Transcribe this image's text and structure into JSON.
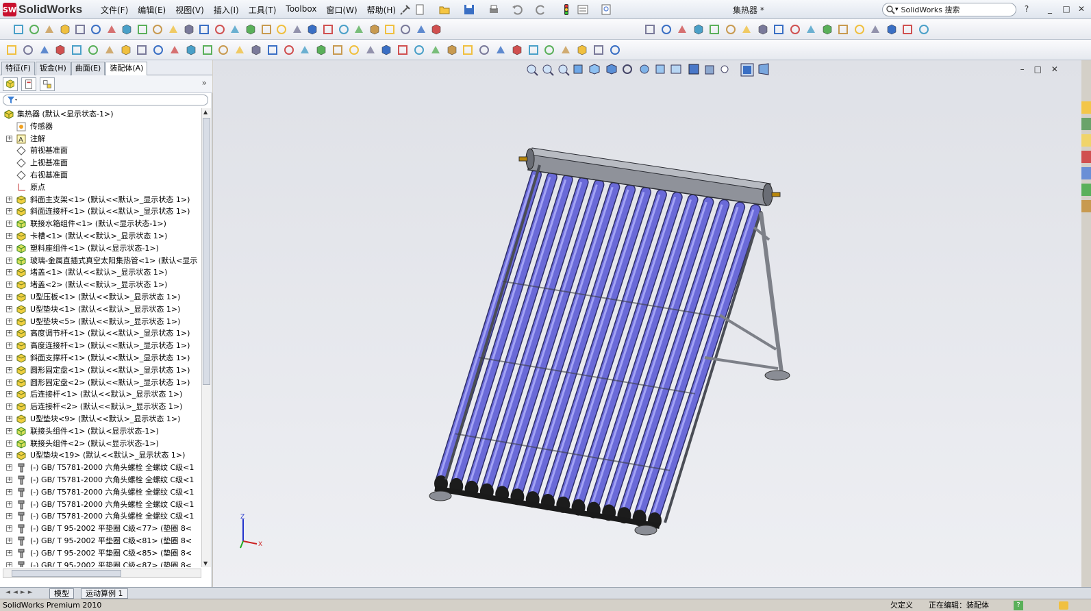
{
  "app": {
    "brand": "SolidWorks",
    "logo_letters": "SW",
    "document_title": "集热器 *",
    "search_placeholder": "SolidWorks 搜索"
  },
  "menus": [
    "文件(F)",
    "编辑(E)",
    "视图(V)",
    "插入(I)",
    "工具(T)",
    "Toolbox",
    "窗口(W)",
    "帮助(H)"
  ],
  "command_manager_tabs": [
    "特征(F)",
    "钣金(H)",
    "曲面(E)",
    "装配体(A)"
  ],
  "active_tab": "装配体(A)",
  "tree": {
    "root": "集热器  (默认<显示状态-1>)",
    "items": [
      {
        "label": "传感器",
        "icon": "sensor-icon",
        "expandable": false
      },
      {
        "label": "注解",
        "icon": "annotation-icon",
        "expandable": true
      },
      {
        "label": "前视基准面",
        "icon": "plane-icon",
        "expandable": false
      },
      {
        "label": "上视基准面",
        "icon": "plane-icon",
        "expandable": false
      },
      {
        "label": "右视基准面",
        "icon": "plane-icon",
        "expandable": false
      },
      {
        "label": "原点",
        "icon": "origin-icon",
        "expandable": false
      },
      {
        "label": "斜面主支架<1> (默认<<默认>_显示状态 1>)",
        "icon": "part-icon",
        "expandable": true
      },
      {
        "label": "斜面连接杆<1> (默认<<默认>_显示状态 1>)",
        "icon": "part-icon",
        "expandable": true
      },
      {
        "label": "联接水箱组件<1> (默认<显示状态-1>)",
        "icon": "subassembly-icon",
        "expandable": true
      },
      {
        "label": "卡槽<1> (默认<<默认>_显示状态 1>)",
        "icon": "part-icon",
        "expandable": true
      },
      {
        "label": "塑料座组件<1> (默认<显示状态-1>)",
        "icon": "subassembly-icon",
        "expandable": true
      },
      {
        "label": "玻璃-金属直插式真空太阳集热管<1> (默认<显示",
        "icon": "subassembly-icon",
        "expandable": true
      },
      {
        "label": "堵盖<1> (默认<<默认>_显示状态 1>)",
        "icon": "part-icon",
        "expandable": true
      },
      {
        "label": "堵盖<2> (默认<<默认>_显示状态 1>)",
        "icon": "part-icon",
        "expandable": true
      },
      {
        "label": "U型压板<1> (默认<<默认>_显示状态 1>)",
        "icon": "part-icon",
        "expandable": true
      },
      {
        "label": "U型垫块<1> (默认<<默认>_显示状态 1>)",
        "icon": "part-icon",
        "expandable": true
      },
      {
        "label": "U型垫块<5> (默认<<默认>_显示状态 1>)",
        "icon": "part-icon",
        "expandable": true
      },
      {
        "label": "高度调节杆<1> (默认<<默认>_显示状态 1>)",
        "icon": "part-icon",
        "expandable": true
      },
      {
        "label": "高度连接杆<1> (默认<<默认>_显示状态 1>)",
        "icon": "part-icon",
        "expandable": true
      },
      {
        "label": "斜面支撑杆<1> (默认<<默认>_显示状态 1>)",
        "icon": "part-icon",
        "expandable": true
      },
      {
        "label": "圆形固定盘<1> (默认<<默认>_显示状态 1>)",
        "icon": "part-icon",
        "expandable": true
      },
      {
        "label": "圆形固定盘<2> (默认<<默认>_显示状态 1>)",
        "icon": "part-icon",
        "expandable": true
      },
      {
        "label": "后连接杆<1> (默认<<默认>_显示状态 1>)",
        "icon": "part-icon",
        "expandable": true
      },
      {
        "label": "后连接杆<2> (默认<<默认>_显示状态 1>)",
        "icon": "part-icon",
        "expandable": true
      },
      {
        "label": "U型垫块<9> (默认<<默认>_显示状态 1>)",
        "icon": "part-icon",
        "expandable": true
      },
      {
        "label": "联接头组件<1> (默认<显示状态-1>)",
        "icon": "subassembly-icon",
        "expandable": true
      },
      {
        "label": "联接头组件<2> (默认<显示状态-1>)",
        "icon": "subassembly-icon",
        "expandable": true
      },
      {
        "label": "U型垫块<19> (默认<<默认>_显示状态 1>)",
        "icon": "part-icon",
        "expandable": true
      },
      {
        "label": "(-) GB/ T5781-2000 六角头螺栓 全螺纹 C级<1",
        "icon": "toolbox-bolt-icon",
        "expandable": true
      },
      {
        "label": "(-) GB/ T5781-2000 六角头螺栓 全螺纹 C级<1",
        "icon": "toolbox-bolt-icon",
        "expandable": true
      },
      {
        "label": "(-) GB/ T5781-2000 六角头螺栓 全螺纹 C级<1",
        "icon": "toolbox-bolt-icon",
        "expandable": true
      },
      {
        "label": "(-) GB/ T5781-2000 六角头螺栓 全螺纹 C级<1",
        "icon": "toolbox-bolt-icon",
        "expandable": true
      },
      {
        "label": "(-) GB/ T5781-2000 六角头螺栓 全螺纹 C级<1",
        "icon": "toolbox-bolt-icon",
        "expandable": true
      },
      {
        "label": "(-) GB/ T 95-2002 平垫圈 C级<77> (垫圈 8<",
        "icon": "toolbox-bolt-icon",
        "expandable": true
      },
      {
        "label": "(-) GB/ T 95-2002 平垫圈 C级<81> (垫圈 8<",
        "icon": "toolbox-bolt-icon",
        "expandable": true
      },
      {
        "label": "(-) GB/ T 95-2002 平垫圈 C级<85> (垫圈 8<",
        "icon": "toolbox-bolt-icon",
        "expandable": true
      },
      {
        "label": "(-) GB/ T 95-2002 平垫圈 C级<87> (垫圈 8<",
        "icon": "toolbox-bolt-icon",
        "expandable": true
      }
    ]
  },
  "bottom_tabs": [
    "模型",
    "运动算例 1"
  ],
  "status": {
    "product": "SolidWorks Premium 2010",
    "definition": "欠定义",
    "editing": "正在编辑：装配体"
  },
  "triad": {
    "x": "X",
    "y": "Y",
    "z": "Z"
  },
  "colors": {
    "tube": "#6a6ad8",
    "tube_highlight": "#a3a3f5",
    "frame": "#7d8088",
    "viewport_bg": "#e4e6eb"
  }
}
